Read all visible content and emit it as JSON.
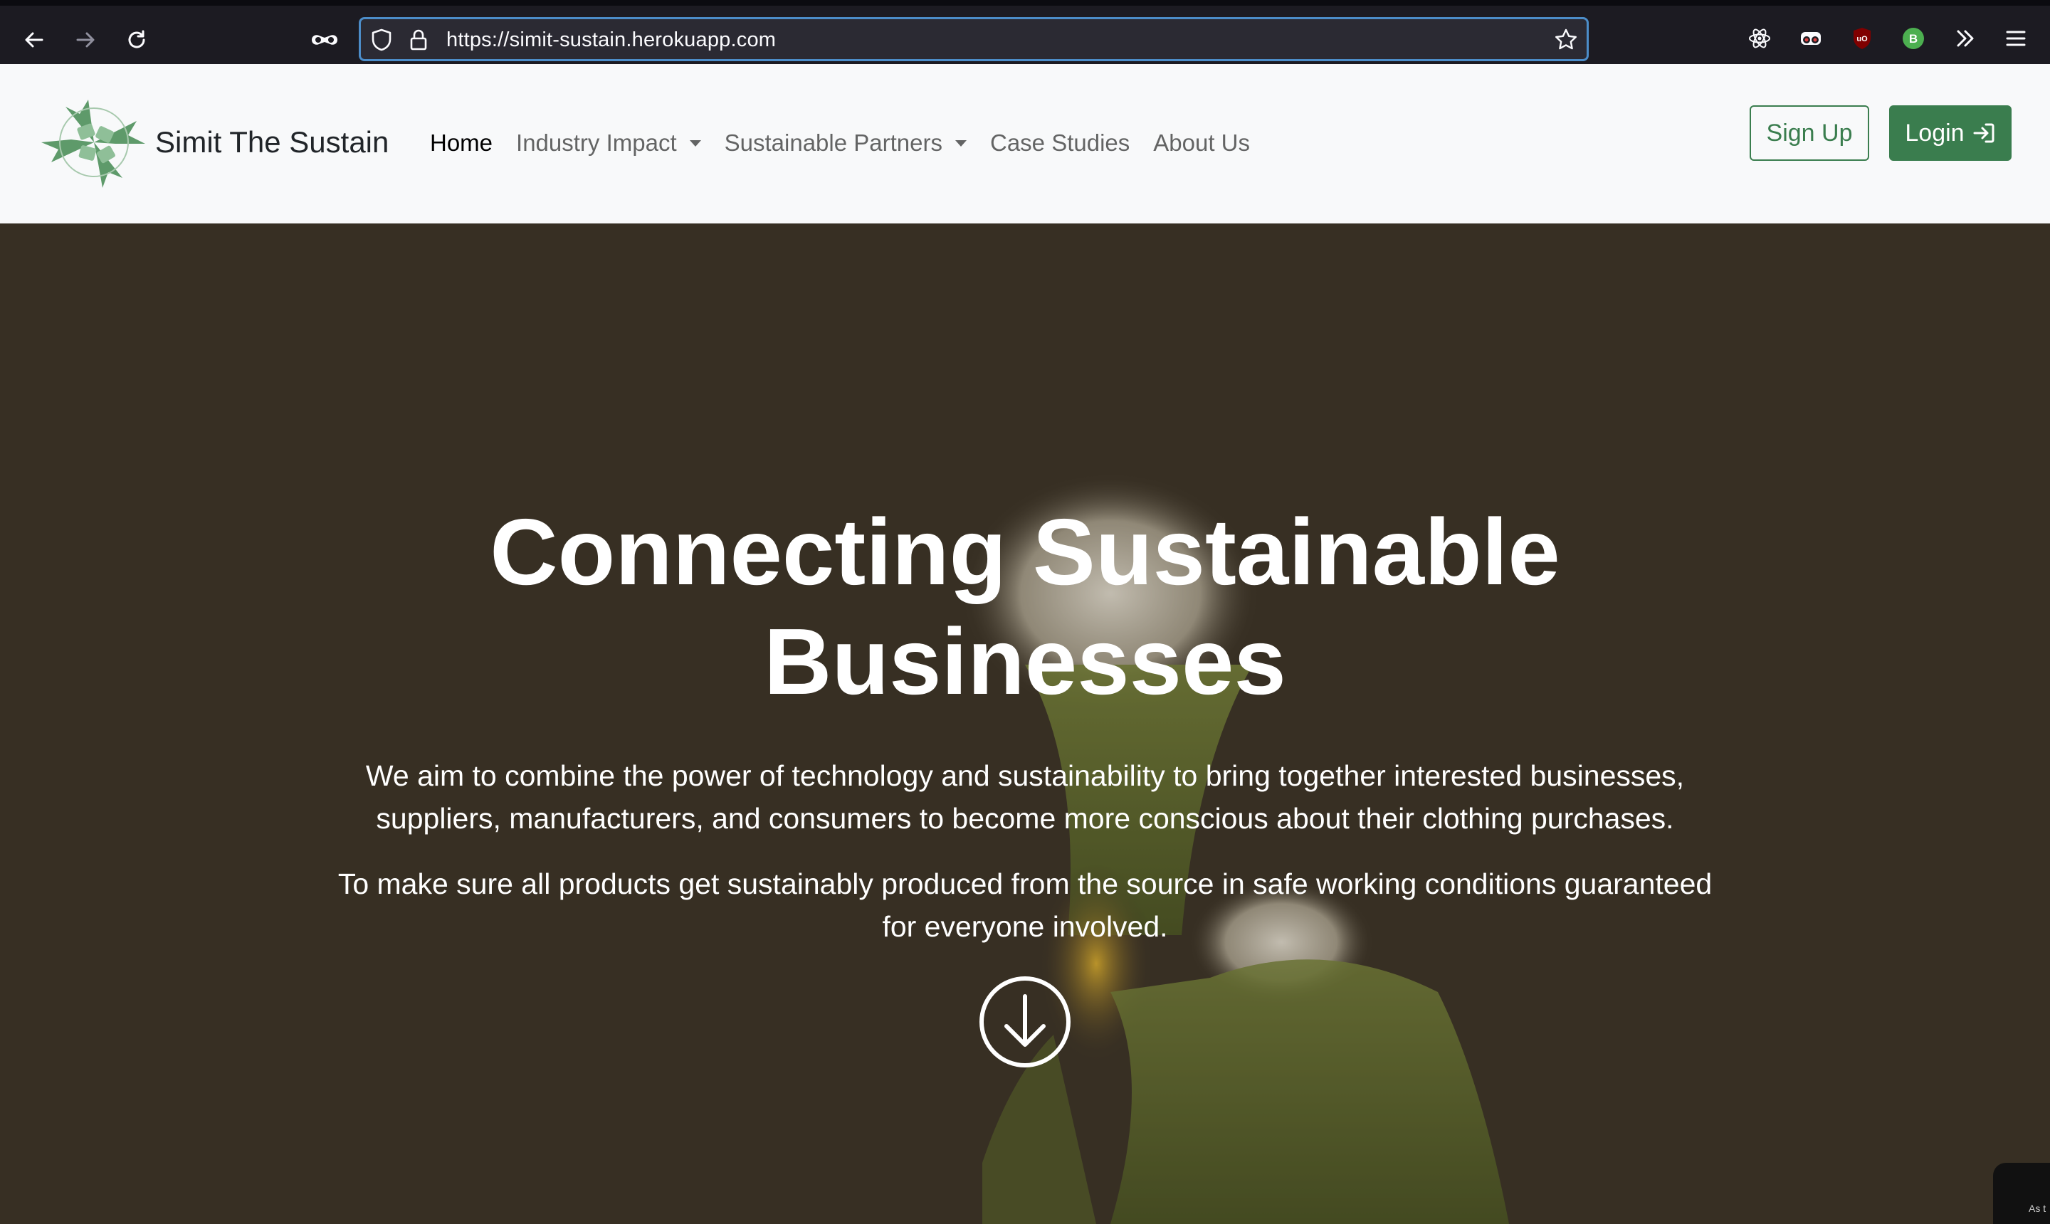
{
  "browser": {
    "url": "https://simit-sustain.herokuapp.com"
  },
  "site": {
    "brand": "Simit The Sustain",
    "nav": {
      "home": "Home",
      "industry_impact": "Industry Impact",
      "sustainable_partners": "Sustainable Partners",
      "case_studies": "Case Studies",
      "about_us": "About Us"
    },
    "signup": "Sign Up",
    "login": "Login"
  },
  "hero": {
    "title_line1": "Connecting Sustainable",
    "title_line2": "Businesses",
    "paragraph1_line1": "We aim to combine the power of technology and sustainability to bring together interested businesses,",
    "paragraph1_line2": "suppliers, manufacturers, and consumers to become more conscious about their clothing purchases.",
    "paragraph2_line1": "To make sure all products get sustainably produced from the source in safe working conditions guaranteed",
    "paragraph2_line2": "for everyone involved.",
    "corner_snippet": "As t"
  },
  "colors": {
    "brand_green": "#3a7d4e",
    "navbar_bg": "#f8f9fa",
    "hero_bg": "#3a3226",
    "chrome_bg": "#1c1b22",
    "url_focus": "#4c8dc9"
  }
}
